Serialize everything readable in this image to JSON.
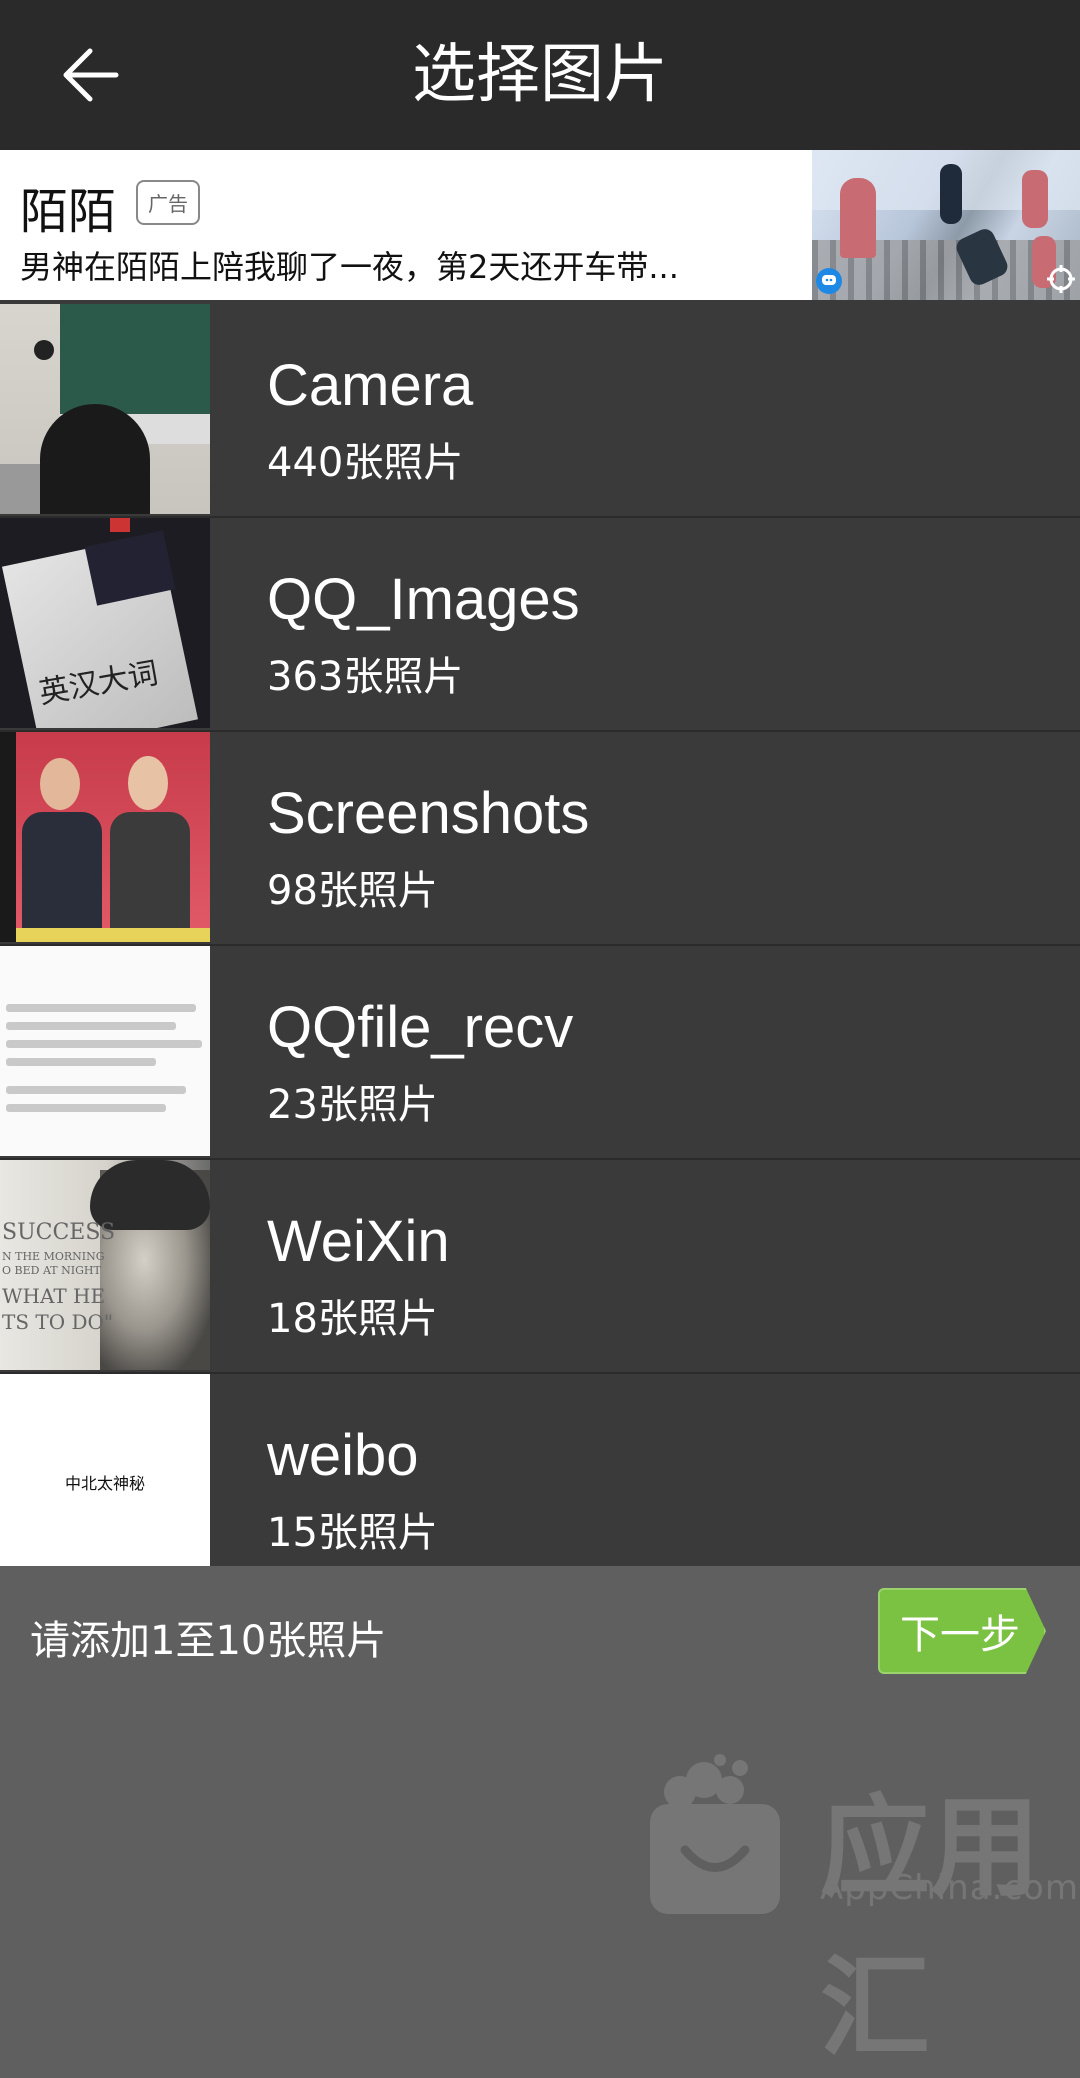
{
  "header": {
    "title": "选择图片",
    "back_icon": "arrow-left-icon"
  },
  "ad": {
    "brand": "陌陌",
    "tag": "广告",
    "text": "男神在陌陌上陪我聊了一夜，第2天还开车带..."
  },
  "albums": [
    {
      "name": "Camera",
      "count": "440张照片"
    },
    {
      "name": "QQ_Images",
      "count": "363张照片"
    },
    {
      "name": "Screenshots",
      "count": "98张照片"
    },
    {
      "name": "QQfile_recv",
      "count": "23张照片"
    },
    {
      "name": "WeiXin",
      "count": "18张照片"
    },
    {
      "name": "weibo",
      "count": "15张照片"
    }
  ],
  "thumb_text": {
    "qq_images": "英汉大词",
    "weixin_lines": [
      "SUCCESS",
      "N THE MORNING",
      "O BED AT NIGHT",
      "WHAT HE",
      "TS TO DO\""
    ],
    "weibo": "中北太神秘"
  },
  "footer": {
    "hint": "请添加1至10张照片",
    "next_label": "下一步",
    "next_color": "#7bc142"
  },
  "watermark": {
    "cn": "应用汇",
    "en": "AppChina.com"
  }
}
